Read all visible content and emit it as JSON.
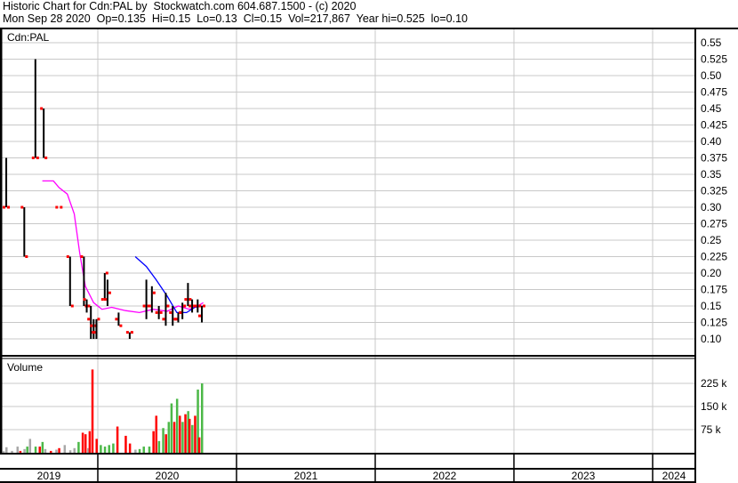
{
  "header": {
    "line1": "Historic Chart for Cdn:PAL by  Stockwatch.com 604.687.1500 - (c) 2020",
    "line2": "Mon Sep 28 2020  Op=0.135  Hi=0.15  Lo=0.13  Cl=0.15  Vol=217,867  Year hi=0.525  lo=0.10"
  },
  "colors": {
    "up": "#4cb848",
    "down": "#ff0000",
    "neutral": "#a8a8a8",
    "ma_long": "#ff00ff",
    "ma_short": "#0000ff",
    "grid": "#c8c8c8"
  },
  "chart_data": {
    "type": "ohlc",
    "title": "Cdn:PAL",
    "volume_title": "Volume",
    "price_ticks": [
      "0.55",
      "0.525",
      "0.50",
      "0.475",
      "0.45",
      "0.425",
      "0.40",
      "0.375",
      "0.35",
      "0.325",
      "0.30",
      "0.275",
      "0.25",
      "0.225",
      "0.20",
      "0.175",
      "0.15",
      "0.125",
      "0.10"
    ],
    "ylim": [
      0.1,
      0.55
    ],
    "volume_ticks": [
      {
        "v": 225,
        "label": "225 k"
      },
      {
        "v": 150,
        "label": "150 k"
      },
      {
        "v": 75,
        "label": "75 k"
      }
    ],
    "years": [
      "2019",
      "2020",
      "2021",
      "2022",
      "2023",
      "2024"
    ],
    "xlim": [
      2019.3,
      2024.31
    ],
    "bars": [
      {
        "t": 2019.34,
        "o": 0.3,
        "h": 0.375,
        "l": 0.3,
        "c": 0.3
      },
      {
        "t": 2019.47,
        "o": 0.3,
        "h": 0.3,
        "l": 0.225,
        "c": 0.225
      },
      {
        "t": 2019.55,
        "o": 0.375,
        "h": 0.525,
        "l": 0.375,
        "c": 0.375
      },
      {
        "t": 2019.61,
        "o": 0.45,
        "h": 0.45,
        "l": 0.375,
        "c": 0.375
      },
      {
        "t": 2019.72,
        "o": 0.3,
        "h": 0.3,
        "l": 0.3,
        "c": 0.3
      },
      {
        "t": 2019.8,
        "o": 0.225,
        "h": 0.225,
        "l": 0.15,
        "c": 0.15
      },
      {
        "t": 2019.9,
        "o": 0.225,
        "h": 0.225,
        "l": 0.15,
        "c": 0.15
      },
      {
        "t": 2019.92,
        "o": 0.16,
        "h": 0.16,
        "l": 0.14,
        "c": 0.15
      },
      {
        "t": 2019.95,
        "o": 0.13,
        "h": 0.15,
        "l": 0.1,
        "c": 0.11
      },
      {
        "t": 2019.97,
        "o": 0.12,
        "h": 0.13,
        "l": 0.1,
        "c": 0.12
      },
      {
        "t": 2019.99,
        "o": 0.11,
        "h": 0.13,
        "l": 0.1,
        "c": 0.13
      },
      {
        "t": 2020.05,
        "o": 0.16,
        "h": 0.2,
        "l": 0.16,
        "c": 0.2
      },
      {
        "t": 2020.07,
        "o": 0.16,
        "h": 0.19,
        "l": 0.15,
        "c": 0.17
      },
      {
        "t": 2020.15,
        "o": 0.13,
        "h": 0.14,
        "l": 0.12,
        "c": 0.12
      },
      {
        "t": 2020.23,
        "o": 0.11,
        "h": 0.11,
        "l": 0.1,
        "c": 0.11
      },
      {
        "t": 2020.35,
        "o": 0.15,
        "h": 0.19,
        "l": 0.13,
        "c": 0.15
      },
      {
        "t": 2020.39,
        "o": 0.15,
        "h": 0.18,
        "l": 0.14,
        "c": 0.17
      },
      {
        "t": 2020.44,
        "o": 0.14,
        "h": 0.15,
        "l": 0.13,
        "c": 0.14
      },
      {
        "t": 2020.49,
        "o": 0.13,
        "h": 0.17,
        "l": 0.12,
        "c": 0.15
      },
      {
        "t": 2020.54,
        "o": 0.14,
        "h": 0.15,
        "l": 0.12,
        "c": 0.13
      },
      {
        "t": 2020.58,
        "o": 0.13,
        "h": 0.14,
        "l": 0.125,
        "c": 0.14
      },
      {
        "t": 2020.61,
        "o": 0.14,
        "h": 0.155,
        "l": 0.13,
        "c": 0.15
      },
      {
        "t": 2020.65,
        "o": 0.16,
        "h": 0.185,
        "l": 0.15,
        "c": 0.16
      },
      {
        "t": 2020.68,
        "o": 0.15,
        "h": 0.16,
        "l": 0.14,
        "c": 0.15
      },
      {
        "t": 2020.72,
        "o": 0.15,
        "h": 0.16,
        "l": 0.14,
        "c": 0.15
      },
      {
        "t": 2020.75,
        "o": 0.135,
        "h": 0.15,
        "l": 0.125,
        "c": 0.15
      }
    ],
    "ma_long": [
      [
        2019.6,
        0.34
      ],
      [
        2019.68,
        0.34
      ],
      [
        2019.72,
        0.33
      ],
      [
        2019.78,
        0.32
      ],
      [
        2019.83,
        0.29
      ],
      [
        2019.87,
        0.23
      ],
      [
        2019.91,
        0.18
      ],
      [
        2019.97,
        0.155
      ],
      [
        2020.03,
        0.145
      ],
      [
        2020.1,
        0.148
      ],
      [
        2020.2,
        0.143
      ],
      [
        2020.3,
        0.14
      ],
      [
        2020.4,
        0.145
      ],
      [
        2020.5,
        0.142
      ],
      [
        2020.58,
        0.15
      ],
      [
        2020.66,
        0.145
      ],
      [
        2020.72,
        0.15
      ],
      [
        2020.76,
        0.155
      ]
    ],
    "ma_short": [
      [
        2020.27,
        0.225
      ],
      [
        2020.35,
        0.21
      ],
      [
        2020.42,
        0.19
      ],
      [
        2020.5,
        0.165
      ],
      [
        2020.57,
        0.14
      ],
      [
        2020.64,
        0.14
      ],
      [
        2020.7,
        0.148
      ],
      [
        2020.76,
        0.15
      ]
    ],
    "volume": [
      [
        2019.32,
        5,
        "n"
      ],
      [
        2019.34,
        18,
        "n"
      ],
      [
        2019.38,
        6,
        "n"
      ],
      [
        2019.42,
        20,
        "n"
      ],
      [
        2019.44,
        6,
        "d"
      ],
      [
        2019.47,
        12,
        "n"
      ],
      [
        2019.49,
        20,
        "u"
      ],
      [
        2019.51,
        45,
        "n"
      ],
      [
        2019.55,
        20,
        "u"
      ],
      [
        2019.58,
        20,
        "d"
      ],
      [
        2019.6,
        35,
        "u"
      ],
      [
        2019.62,
        12,
        "n"
      ],
      [
        2019.66,
        6,
        "d"
      ],
      [
        2019.7,
        10,
        "n"
      ],
      [
        2019.72,
        15,
        "d"
      ],
      [
        2019.76,
        25,
        "n"
      ],
      [
        2019.8,
        8,
        "n"
      ],
      [
        2019.83,
        15,
        "n"
      ],
      [
        2019.86,
        35,
        "u"
      ],
      [
        2019.89,
        65,
        "d"
      ],
      [
        2019.91,
        60,
        "d"
      ],
      [
        2019.93,
        15,
        "n"
      ],
      [
        2019.94,
        70,
        "d"
      ],
      [
        2019.96,
        270,
        "d"
      ],
      [
        2019.99,
        45,
        "d"
      ],
      [
        2020.02,
        25,
        "u"
      ],
      [
        2020.05,
        20,
        "u"
      ],
      [
        2020.08,
        25,
        "u"
      ],
      [
        2020.11,
        30,
        "u"
      ],
      [
        2020.14,
        85,
        "d"
      ],
      [
        2020.2,
        55,
        "d"
      ],
      [
        2020.23,
        30,
        "d"
      ],
      [
        2020.27,
        10,
        "n"
      ],
      [
        2020.3,
        12,
        "u"
      ],
      [
        2020.33,
        20,
        "u"
      ],
      [
        2020.37,
        20,
        "u"
      ],
      [
        2020.4,
        70,
        "d"
      ],
      [
        2020.42,
        120,
        "d"
      ],
      [
        2020.44,
        38,
        "u"
      ],
      [
        2020.47,
        80,
        "u"
      ],
      [
        2020.49,
        60,
        "d"
      ],
      [
        2020.51,
        100,
        "u"
      ],
      [
        2020.53,
        160,
        "u"
      ],
      [
        2020.55,
        100,
        "d"
      ],
      [
        2020.57,
        175,
        "u"
      ],
      [
        2020.59,
        120,
        "d"
      ],
      [
        2020.61,
        100,
        "u"
      ],
      [
        2020.63,
        125,
        "d"
      ],
      [
        2020.65,
        135,
        "u"
      ],
      [
        2020.66,
        110,
        "d"
      ],
      [
        2020.68,
        90,
        "u"
      ],
      [
        2020.7,
        120,
        "d"
      ],
      [
        2020.72,
        205,
        "u"
      ],
      [
        2020.73,
        50,
        "d"
      ],
      [
        2020.75,
        225,
        "u"
      ]
    ]
  }
}
